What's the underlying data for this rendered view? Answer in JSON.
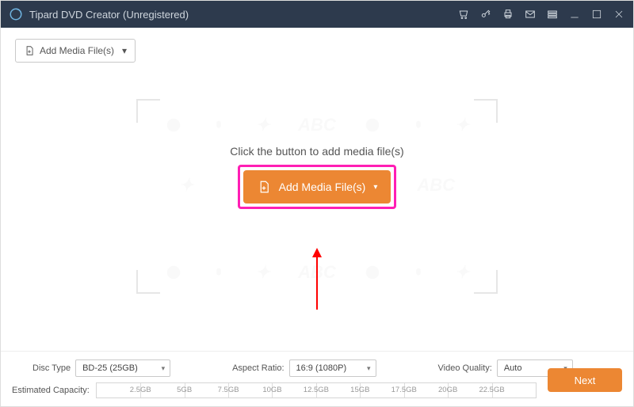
{
  "titlebar": {
    "app_title": "Tipard DVD Creator (Unregistered)"
  },
  "toolbar": {
    "add_media_label": "Add Media File(s)"
  },
  "center": {
    "prompt": "Click the button to add media file(s)",
    "add_media_label": "Add Media File(s)",
    "watermark_text": "ABC"
  },
  "bottom": {
    "disc_type_label": "Disc Type",
    "disc_type_value": "BD-25 (25GB)",
    "aspect_ratio_label": "Aspect Ratio:",
    "aspect_ratio_value": "16:9 (1080P)",
    "video_quality_label": "Video Quality:",
    "video_quality_value": "Auto",
    "estimated_capacity_label": "Estimated Capacity:",
    "capacity_ticks": [
      "2.5GB",
      "5GB",
      "7.5GB",
      "10GB",
      "12.5GB",
      "15GB",
      "17.5GB",
      "20GB",
      "22.5GB"
    ],
    "next_label": "Next"
  },
  "colors": {
    "accent": "#ec8733",
    "highlight": "#ff1eb4",
    "titlebar": "#2d3a4d"
  }
}
